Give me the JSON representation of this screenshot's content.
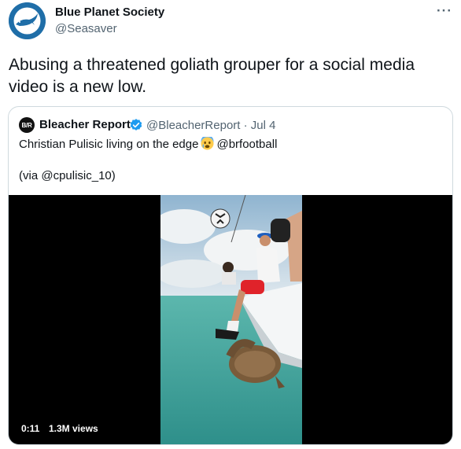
{
  "author": {
    "display_name": "Blue Planet Society",
    "handle": "@Seasaver"
  },
  "more_icon": "···",
  "tweet_text": "Abusing a threatened goliath grouper for a social media video is a new low.",
  "quoted_tweet": {
    "avatar_text": "B/R",
    "display_name": "Bleacher Report",
    "handle_and_date": "@BleacherReport · Jul 4",
    "text_before_emoji": "Christian Pulisic living on the edge",
    "emoji": "fearful-face",
    "text_after_emoji": "@brfootball",
    "via_line": "(via @cpulisic_10)",
    "video": {
      "timestamp": "0:11",
      "views": "1.3M views"
    }
  },
  "colors": {
    "primary_text": "#0f1419",
    "secondary_text": "#536471",
    "verified": "#1d9bf0",
    "border": "#cfd9de",
    "avatar_bg": "#1f6ea8"
  }
}
